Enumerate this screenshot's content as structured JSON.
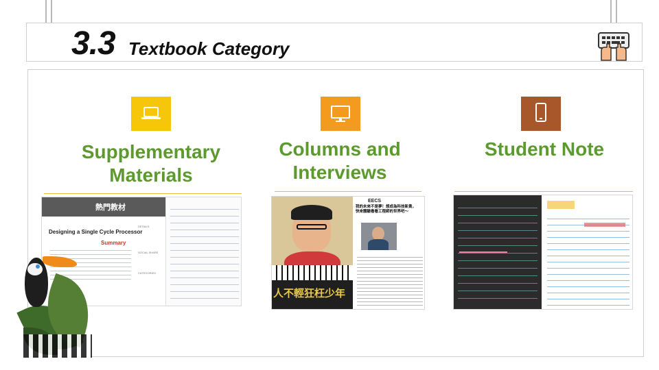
{
  "slide": {
    "section_number": "3.3",
    "section_title": "Textbook Category"
  },
  "categories": [
    {
      "title_line1": "Supplementary",
      "title_line2": "Materials",
      "icon": "laptop-icon",
      "icon_color": "#f6c60b"
    },
    {
      "title_line1": "Columns and",
      "title_line2": "Interviews",
      "icon": "monitor-icon",
      "icon_color": "#f39b1f"
    },
    {
      "title_line1": "Student Note",
      "title_line2": "",
      "icon": "smartphone-icon",
      "icon_color": "#a8572b"
    }
  ],
  "thumbnails": {
    "supplementary": {
      "banner": "熱門教材",
      "doc_title": "Designing a Single Cycle Processor",
      "summary_heading": "Summary",
      "sidebar_details": "DETAILS",
      "sidebar_social": "SOCIAL SHARE",
      "sidebar_categories": "CATEGORIES"
    },
    "interviews": {
      "magazine_header": "EECS",
      "headline_line1": "我的未來不是夢！想成為科技新貴，",
      "headline_line2": "快來體驗看看工程師的世界吧～",
      "cover_caption": "人不輕狂枉少年"
    }
  },
  "colors": {
    "accent_green": "#5c9a2e",
    "rule_gold": "#e2c044",
    "chalkboard": "#2b2b2b"
  }
}
